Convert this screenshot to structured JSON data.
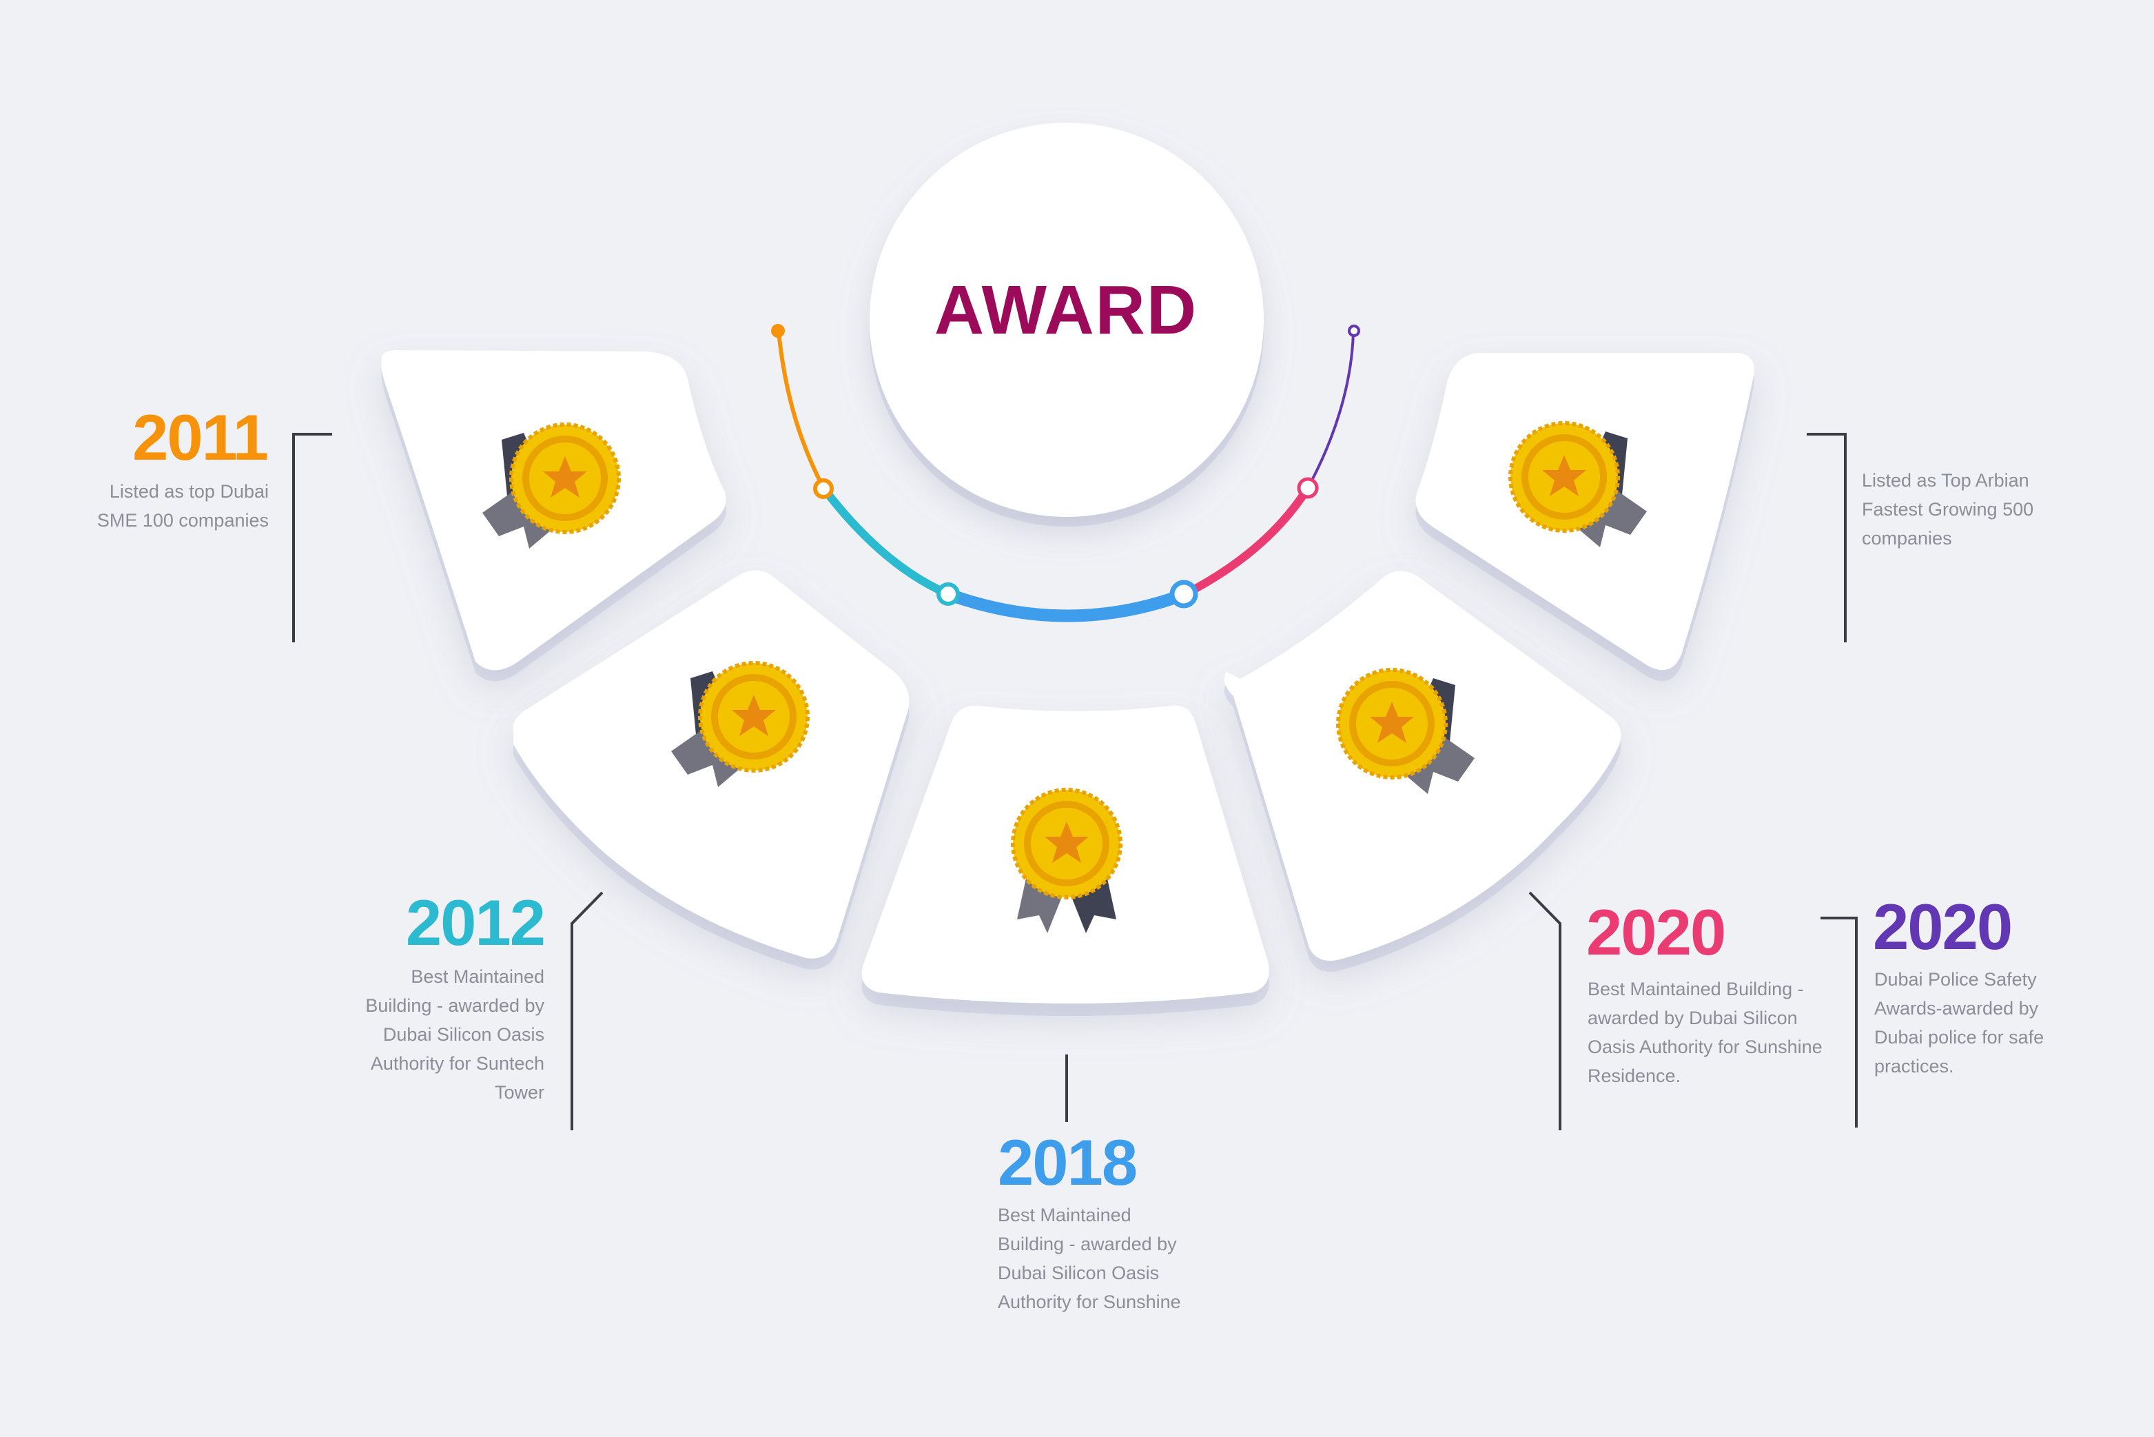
{
  "center": {
    "title": "AWARD",
    "color": "#9b0b5a"
  },
  "timeline_colors": [
    "#f7930a",
    "#2bbad0",
    "#3f9eeb",
    "#ea3c72",
    "#6237b3"
  ],
  "milestones": [
    {
      "year": "2011",
      "text": "Listed as top Dubai\nSME 100 companies",
      "color": "#f7930a"
    },
    {
      "year": "2012",
      "text": "Best Maintained\nBuilding - awarded  by\nDubai Silicon  Oasis\nAuthority for  Suntech\nTower",
      "color": "#2bbad0"
    },
    {
      "year": "2018",
      "text": "Best Maintained\nBuilding - awarded by\nDubai Silicon  Oasis\nAuthority for  Sunshine",
      "color": "#3f9eeb"
    },
    {
      "year": "2020",
      "text": "Best Maintained  Building -\nawarded by  Dubai Silicon\nOasis Authority for  Sunshine\nResidence.",
      "color": "#ea3c72"
    },
    {
      "year": "2020",
      "text": "Dubai Police Safety\nAwards-awarded by\nDubai police for safe\npractices.",
      "color": "#6237b3"
    }
  ],
  "right_note": {
    "text": "Listed as Top Arbian\nFastest Growing  500\ncompanies"
  },
  "icons": {
    "medal": "award-medal-icon"
  },
  "colors": {
    "background": "#f0f1f5",
    "card": "#ffffff",
    "connector": "#3a3d44",
    "gold": "#f3c300",
    "gold_dark": "#e8a300",
    "star": "#e98a10"
  }
}
